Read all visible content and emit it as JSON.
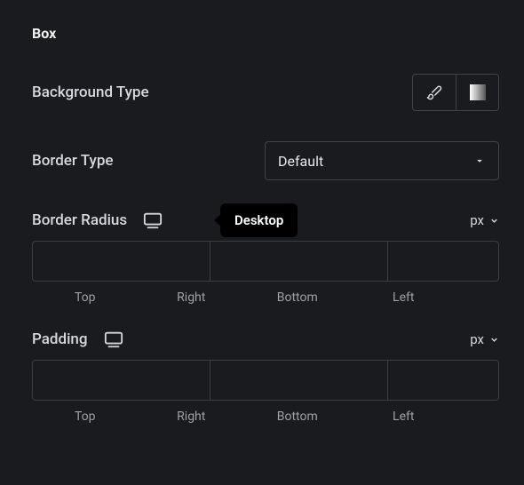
{
  "section": {
    "title": "Box"
  },
  "bg": {
    "label": "Background Type"
  },
  "border_type": {
    "label": "Border Type",
    "value": "Default"
  },
  "radius": {
    "label": "Border Radius",
    "tooltip": "Desktop",
    "unit": "px",
    "sides": {
      "top": "Top",
      "right": "Right",
      "bottom": "Bottom",
      "left": "Left"
    }
  },
  "padding": {
    "label": "Padding",
    "unit": "px",
    "sides": {
      "top": "Top",
      "right": "Right",
      "bottom": "Bottom",
      "left": "Left"
    }
  }
}
